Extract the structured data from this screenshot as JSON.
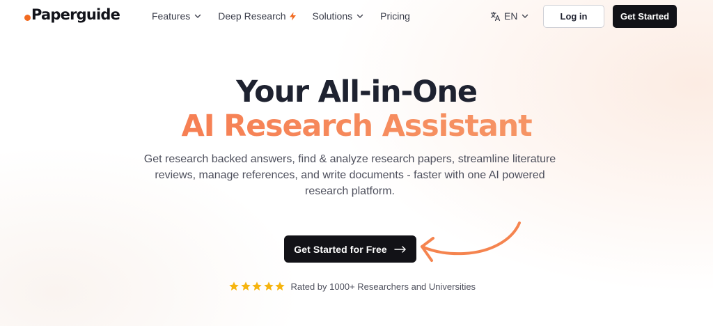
{
  "brand": {
    "name": "Paperguide",
    "accent": "#f26b21"
  },
  "nav": {
    "items": [
      {
        "label": "Features",
        "icon": "chevron-down-icon"
      },
      {
        "label": "Deep Research",
        "icon": "lightning-bolt-icon"
      },
      {
        "label": "Solutions",
        "icon": "chevron-down-icon"
      },
      {
        "label": "Pricing"
      }
    ],
    "language": "EN",
    "login_label": "Log in",
    "get_started_label": "Get Started"
  },
  "hero": {
    "title_line1": "Your All-in-One",
    "title_line2": "AI Research Assistant",
    "subtitle": "Get research backed answers, find & analyze research papers, streamline literature reviews, manage references, and write documents - faster with one AI powered research platform.",
    "cta_label": "Get Started for Free",
    "rating_stars": 5,
    "rating_text": "Rated by 1000+ Researchers and Universities"
  },
  "colors": {
    "star": "#f6b40e",
    "gradient_start": "#f5744a",
    "gradient_end": "#f7a06e",
    "dark": "#121217"
  }
}
